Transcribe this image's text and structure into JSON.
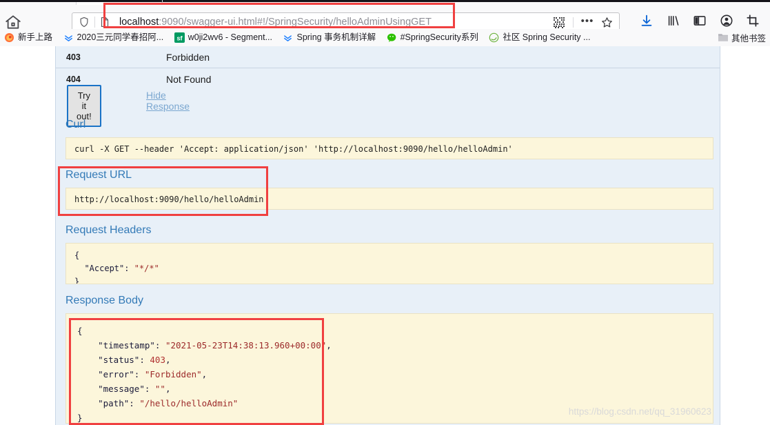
{
  "browser": {
    "home_icon": "home-icon",
    "url": {
      "host": "localhost",
      "rest": ":9090/swagger-ui.html#!/SpringSecurity/helloAdminUsingGET",
      "full": "localhost:9090/swagger-ui.html#!/SpringSecurity/helloAdminUsingGET"
    },
    "urlbar_icons": {
      "shield": "shield-icon",
      "reader": "reader-view-icon",
      "qr": "qr-code-icon",
      "menu_dots": "•••",
      "star": "bookmark-star-icon"
    },
    "toolbar_icons": [
      {
        "name": "downloads-icon",
        "glyph": "download"
      },
      {
        "name": "library-icon",
        "glyph": "library"
      },
      {
        "name": "sidebar-icon",
        "glyph": "sidebar"
      },
      {
        "name": "account-icon",
        "glyph": "account"
      },
      {
        "name": "screenshot-icon",
        "glyph": "crop"
      }
    ],
    "bookmarks": [
      {
        "label": "新手上路",
        "icon": "firefox-icon"
      },
      {
        "label": "2020三元同学春招阿...",
        "icon": "juejin-icon"
      },
      {
        "label": "w0ji2wv6 - Segment...",
        "icon": "segmentfault-icon"
      },
      {
        "label": "Spring 事务机制详解",
        "icon": "juejin-icon"
      },
      {
        "label": "#SpringSecurity系列",
        "icon": "wechat-icon"
      },
      {
        "label": "社区 Spring Security ...",
        "icon": "spring-icon"
      }
    ],
    "other_bookmarks": {
      "label": "其他书签",
      "icon": "folder-icon"
    }
  },
  "swagger": {
    "response_codes": {
      "rows": [
        {
          "code": "403",
          "description": "Forbidden"
        },
        {
          "code": "404",
          "description": "Not Found"
        }
      ]
    },
    "try_it_out_label": "Try it out!",
    "hide_response_label": "Hide Response",
    "curl": {
      "title": "Curl",
      "command": "curl -X GET --header 'Accept: application/json' 'http://localhost:9090/hello/helloAdmin'"
    },
    "request_url": {
      "title": "Request URL",
      "value": "http://localhost:9090/hello/helloAdmin"
    },
    "request_headers": {
      "title": "Request Headers",
      "lines": [
        "{",
        "  \"Accept\": \"*/*\"",
        "}"
      ],
      "accept_key": "\"Accept\"",
      "accept_value": "\"*/*\""
    },
    "response_body": {
      "title": "Response Body",
      "json": {
        "timestamp": "2021-05-23T14:38:13.960+00:00",
        "status": "403",
        "error": "Forbidden",
        "message": "",
        "path": "/hello/helloAdmin"
      },
      "keys": {
        "timestamp": "\"timestamp\"",
        "status": "\"status\"",
        "error": "\"error\"",
        "message": "\"message\"",
        "path": "\"path\""
      },
      "values": {
        "timestamp": "\"2021-05-23T14:38:13.960+00:00\"",
        "status": "403",
        "error": "\"Forbidden\"",
        "message": "\"\"",
        "path": "\"/hello/helloAdmin\""
      },
      "open_brace": "{",
      "close_brace": "}"
    }
  },
  "annotations": {
    "highlight_color": "#f04040",
    "boxes": [
      "url-bar-highlight",
      "request-url-highlight",
      "response-body-highlight"
    ]
  },
  "watermark": {
    "text": "https://blog.csdn.net/qq_31960623"
  }
}
